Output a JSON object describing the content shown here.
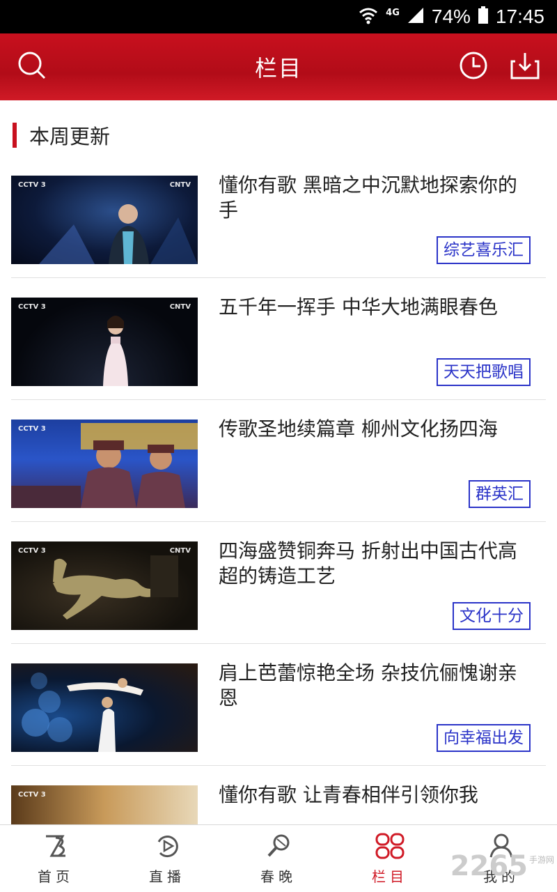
{
  "status": {
    "network": "4G",
    "battery": "74%",
    "time": "17:45"
  },
  "header": {
    "title": "栏目"
  },
  "section": {
    "title": "本周更新"
  },
  "items": [
    {
      "title": "懂你有歌 黑暗之中沉默地探索你的手",
      "tag": "综艺喜乐汇"
    },
    {
      "title": "五千年一挥手 中华大地满眼春色",
      "tag": "天天把歌唱"
    },
    {
      "title": "传歌圣地续篇章 柳州文化扬四海",
      "tag": "群英汇"
    },
    {
      "title": "四海盛赞铜奔马 折射出中国古代高超的铸造工艺",
      "tag": "文化十分"
    },
    {
      "title": "肩上芭蕾惊艳全场 杂技伉俪愧谢亲恩",
      "tag": "向幸福出发"
    },
    {
      "title": "懂你有歌 让青春相伴引领你我",
      "tag": ""
    }
  ],
  "tabs": [
    {
      "label": "首页",
      "icon": "home-icon"
    },
    {
      "label": "直播",
      "icon": "live-icon"
    },
    {
      "label": "春晚",
      "icon": "gala-icon"
    },
    {
      "label": "栏目",
      "icon": "columns-icon",
      "active": true
    },
    {
      "label": "我的",
      "icon": "profile-icon"
    }
  ],
  "thumb_logo": {
    "left": "CCTV 3",
    "right": "CNTV"
  },
  "watermark": {
    "number": "2265",
    "text": "手游网"
  },
  "colors": {
    "brand_red": "#c8101e",
    "tag_blue": "#2a33c8"
  }
}
